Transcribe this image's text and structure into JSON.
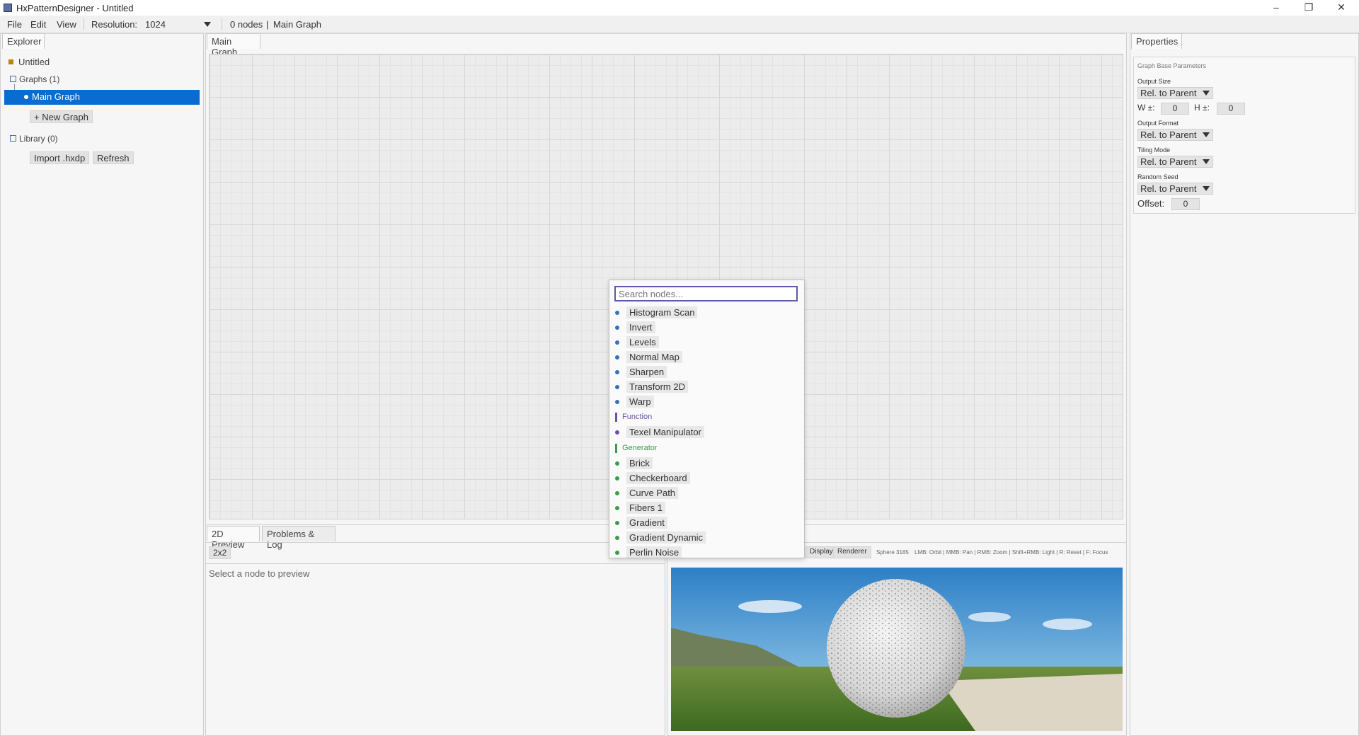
{
  "window": {
    "title": "HxPatternDesigner - Untitled",
    "controls": {
      "minimize": "–",
      "maximize": "❐",
      "close": "✕"
    }
  },
  "menubar": {
    "file": "File",
    "edit": "Edit",
    "view": "View",
    "resolution_label": "Resolution:",
    "resolution_value": "1024",
    "status": "0 nodes",
    "status_sep": "|",
    "graph_name": "Main Graph"
  },
  "explorer": {
    "tab": "Explorer",
    "project": "Untitled",
    "graphs_label": "Graphs (1)",
    "main_graph": "Main Graph",
    "new_graph": "+ New Graph",
    "library_label": "Library (0)",
    "import_btn": "Import .hxdp",
    "refresh_btn": "Refresh"
  },
  "graph": {
    "tab": "Main Graph"
  },
  "preview2d": {
    "tabs": [
      "2D Preview",
      "Problems & Log"
    ],
    "grid_btn": "2x2",
    "placeholder": "Select a node to preview"
  },
  "preview3d": {
    "display_btn": "Display",
    "renderer_btn": "Renderer",
    "info_left": "Sphere 3185",
    "info": "LMB: Orbit | MMB: Pan | RMB: Zoom | Shift+RMB: Light | R: Reset | F: Focus"
  },
  "properties": {
    "tab": "Properties",
    "group_title": "Graph Base Parameters",
    "output_size_label": "Output Size",
    "output_size_value": "Rel. to Parent",
    "w_label": "W ±:",
    "w_value": "0",
    "h_label": "H ±:",
    "h_value": "0",
    "output_format_label": "Output Format",
    "output_format_value": "Rel. to Parent",
    "tiling_label": "Tiling Mode",
    "tiling_value": "Rel. to Parent",
    "seed_label": "Random Seed",
    "seed_value": "Rel. to Parent",
    "offset_label": "Offset:",
    "offset_value": "0"
  },
  "node_popup": {
    "search_placeholder": "Search nodes...",
    "filter_items": [
      "Histogram Scan",
      "Invert",
      "Levels",
      "Normal Map",
      "Sharpen",
      "Transform 2D",
      "Warp"
    ],
    "function_category": "Function",
    "function_items": [
      "Texel Manipulator"
    ],
    "generator_category": "Generator",
    "generator_items": [
      "Brick",
      "Checkerboard",
      "Curve Path",
      "Fibers 1",
      "Gradient",
      "Gradient Dynamic",
      "Perlin Noise"
    ],
    "colors": {
      "filter": "#3a6fb8",
      "function": "#6a4fb0",
      "generator": "#3f9a4a"
    }
  }
}
